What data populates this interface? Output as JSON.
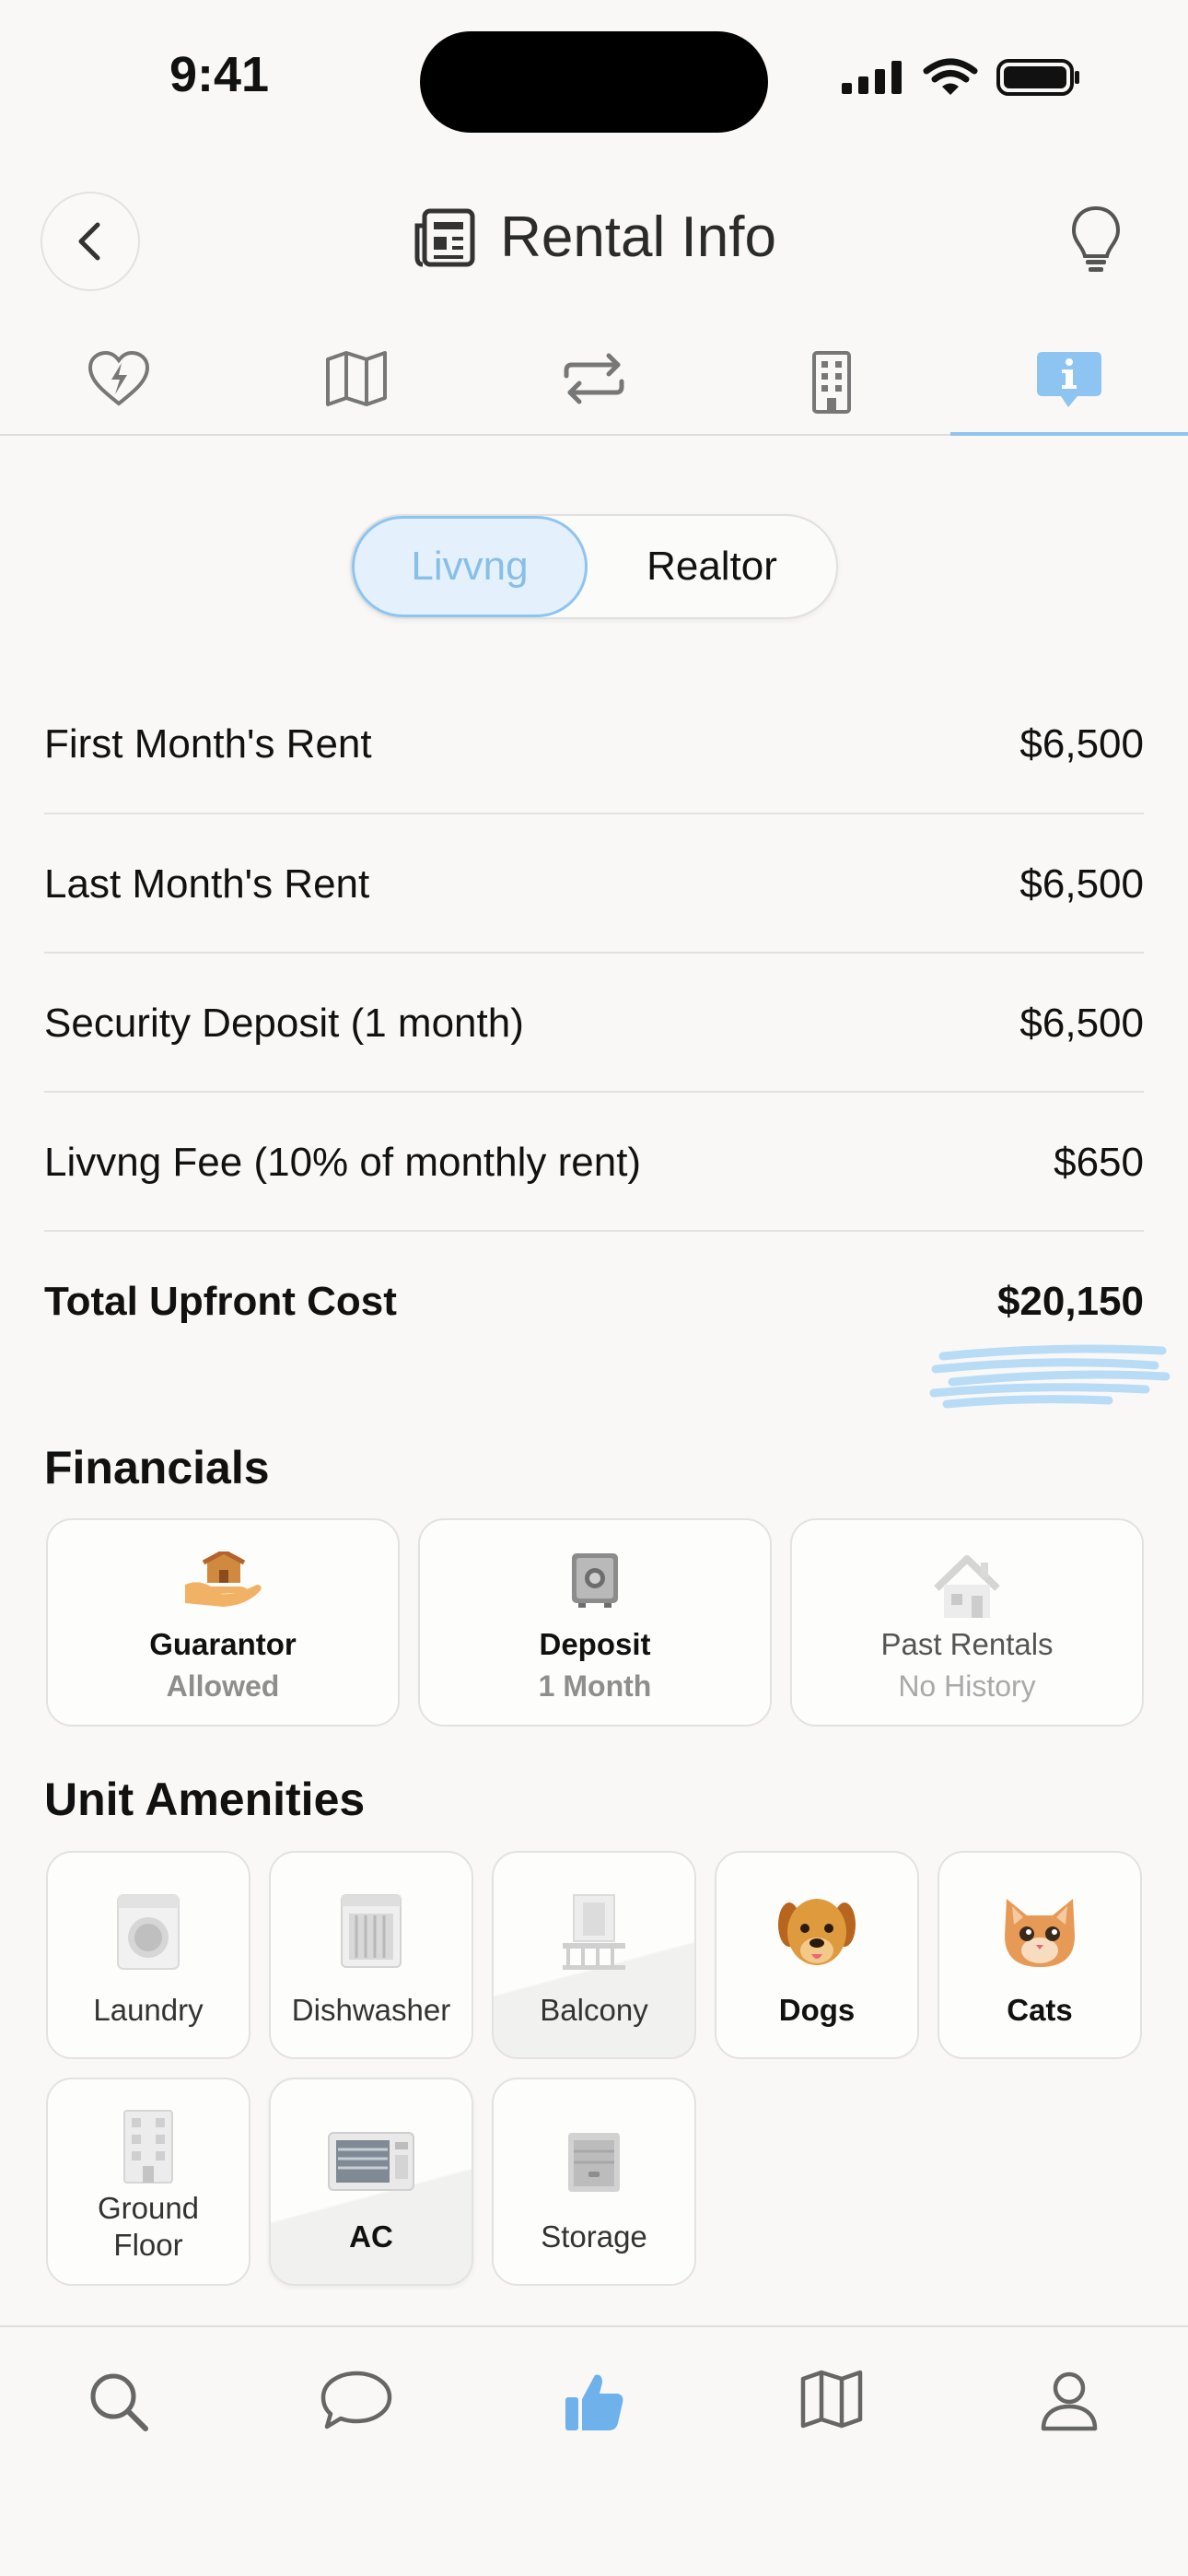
{
  "status_bar": {
    "time": "9:41"
  },
  "header": {
    "title": "Rental Info"
  },
  "tabs": [
    {
      "icon": "heart-bolt-icon"
    },
    {
      "icon": "map-icon"
    },
    {
      "icon": "repeat-icon"
    },
    {
      "icon": "building-icon"
    },
    {
      "icon": "info-bubble-icon",
      "active": true
    }
  ],
  "segment": {
    "options": [
      "Livvng",
      "Realtor"
    ],
    "selected": "Livvng"
  },
  "costs": [
    {
      "label": "First Month's Rent",
      "value": "$6,500"
    },
    {
      "label": "Last Month's Rent",
      "value": "$6,500"
    },
    {
      "label": "Security Deposit (1 month)",
      "value": "$6,500"
    },
    {
      "label": "Livvng Fee (10% of monthly rent)",
      "value": "$650"
    }
  ],
  "total": {
    "label": "Total Upfront Cost",
    "value": "$20,150"
  },
  "financials": {
    "title": "Financials",
    "cards": [
      {
        "label": "Guarantor",
        "value": "Allowed"
      },
      {
        "label": "Deposit",
        "value": "1 Month"
      },
      {
        "label": "Past Rentals",
        "value": "No History"
      }
    ]
  },
  "amenities": {
    "title": "Unit Amenities",
    "items": [
      {
        "label": "Laundry"
      },
      {
        "label": "Dishwasher"
      },
      {
        "label": "Balcony"
      },
      {
        "label": "Dogs"
      },
      {
        "label": "Cats"
      },
      {
        "label": "Ground\nFloor",
        "line1": "Ground",
        "line2": "Floor"
      },
      {
        "label": "AC"
      },
      {
        "label": "Storage"
      }
    ]
  },
  "bottom_nav": [
    {
      "icon": "search-icon"
    },
    {
      "icon": "chat-icon"
    },
    {
      "icon": "thumbs-up-icon",
      "active": true
    },
    {
      "icon": "map-icon"
    },
    {
      "icon": "profile-icon"
    }
  ],
  "colors": {
    "accent": "#8ec4f1",
    "background": "#f9f8f6"
  }
}
